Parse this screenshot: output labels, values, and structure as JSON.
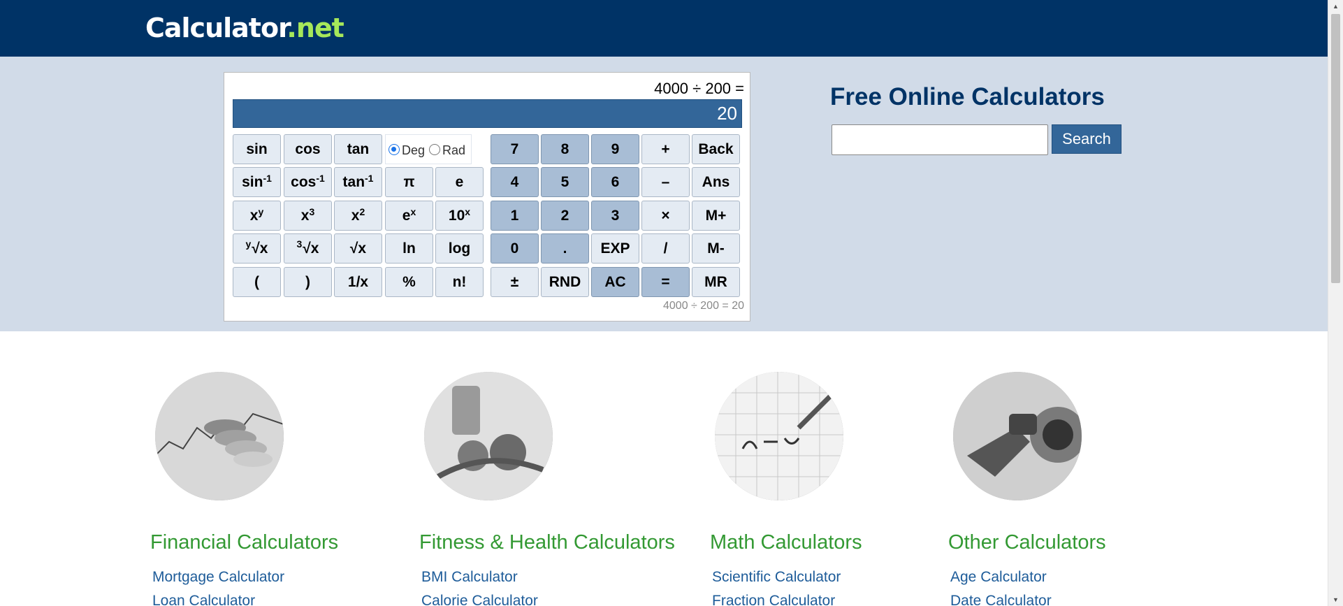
{
  "header": {
    "logo_main": "Calculator",
    "logo_tld": ".net"
  },
  "calculator": {
    "expression": "4000 ÷ 200 =",
    "display_value": "20",
    "history": "4000 ÷ 200 = 20",
    "angle_mode": {
      "deg_label": "Deg",
      "rad_label": "Rad",
      "selected": "Deg"
    },
    "keys": {
      "sin": "sin",
      "cos": "cos",
      "tan": "tan",
      "asin_base": "sin",
      "asin_exp": "-1",
      "acos_base": "cos",
      "acos_exp": "-1",
      "atan_base": "tan",
      "atan_exp": "-1",
      "pi": "π",
      "e": "e",
      "xy_base": "x",
      "xy_exp": "y",
      "x3_base": "x",
      "x3_exp": "3",
      "x2_base": "x",
      "x2_exp": "2",
      "ex_base": "e",
      "ex_exp": "x",
      "tenx_base": "10",
      "tenx_exp": "x",
      "yroot_pre": "y",
      "yroot_main": "√x",
      "cuberoot_pre": "3",
      "cuberoot_main": "√x",
      "sqrt": "√x",
      "ln": "ln",
      "log": "log",
      "lparen": "(",
      "rparen": ")",
      "reciprocal": "1/x",
      "percent": "%",
      "factorial": "n!",
      "seven": "7",
      "eight": "8",
      "nine": "9",
      "plus": "+",
      "back": "Back",
      "four": "4",
      "five": "5",
      "six": "6",
      "minus": "–",
      "ans": "Ans",
      "one": "1",
      "two": "2",
      "three": "3",
      "multiply": "×",
      "mplus": "M+",
      "zero": "0",
      "dot": ".",
      "exp": "EXP",
      "divide": "/",
      "mminus": "M-",
      "plusminus": "±",
      "rnd": "RND",
      "ac": "AC",
      "equals": "=",
      "mr": "MR"
    }
  },
  "search": {
    "title": "Free Online Calculators",
    "button_label": "Search",
    "value": ""
  },
  "categories": [
    {
      "title": "Financial Calculators",
      "links": [
        "Mortgage Calculator",
        "Loan Calculator"
      ]
    },
    {
      "title": "Fitness & Health Calculators",
      "links": [
        "BMI Calculator",
        "Calorie Calculator"
      ]
    },
    {
      "title": "Math Calculators",
      "links": [
        "Scientific Calculator",
        "Fraction Calculator"
      ]
    },
    {
      "title": "Other Calculators",
      "links": [
        "Age Calculator",
        "Date Calculator"
      ]
    }
  ],
  "colors": {
    "header_bg": "#003366",
    "band_bg": "#d1dbe8",
    "display_bg": "#336699",
    "category_title": "#339933",
    "link": "#1e5c99",
    "logo_tld": "#a6e85a"
  }
}
